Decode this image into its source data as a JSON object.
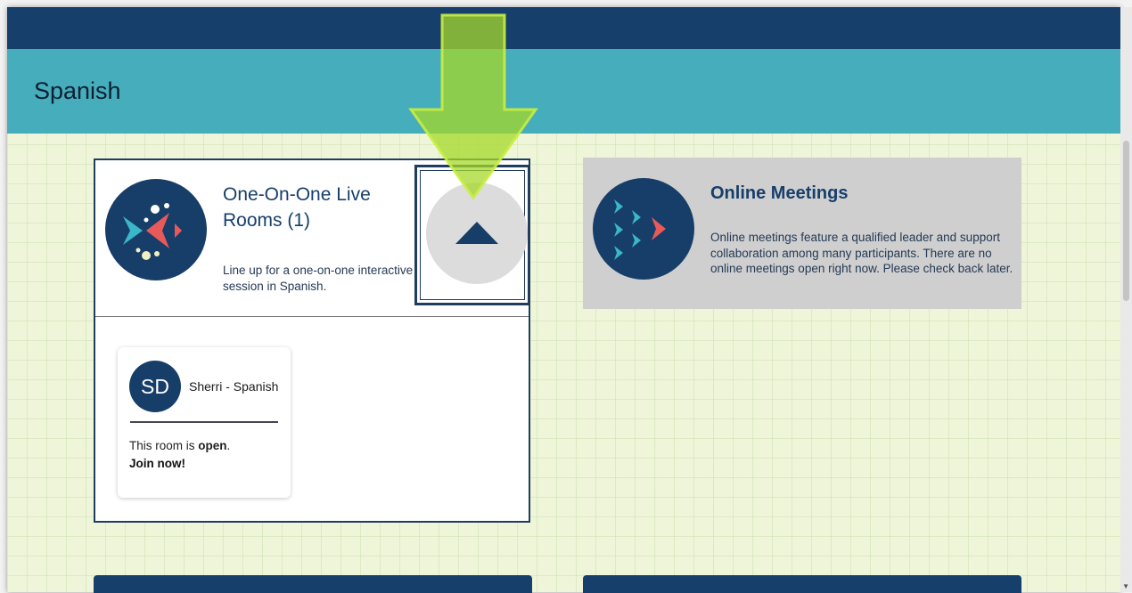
{
  "header": {
    "title": "Spanish"
  },
  "live_rooms": {
    "title": "One-On-One Live Rooms (1)",
    "description": "Line up for a one-on-one interactive session in Spanish.",
    "rooms": [
      {
        "initials": "SD",
        "name": "Sherri - Spanish",
        "status_prefix": "This room is ",
        "status_value": "open",
        "status_suffix": ".",
        "join_label": "Join now!"
      }
    ]
  },
  "online_meetings": {
    "title": "Online Meetings",
    "description": "Online meetings feature a qualified leader and support collaboration among many participants. There are no online meetings open right now. Please check back later."
  },
  "colors": {
    "navy": "#163f6b",
    "teal": "#45adbb",
    "background": "#eef5d8",
    "highlight_arrow": "#a6d82a",
    "coral": "#e85a5a",
    "cyan_fish": "#3ab7c9"
  },
  "icons": {
    "collapse": "triangle-up-icon",
    "annotation": "green-arrow-icon",
    "live_rooms_logo": "fish-logo-icon",
    "meetings_logo": "fish-school-logo-icon"
  }
}
